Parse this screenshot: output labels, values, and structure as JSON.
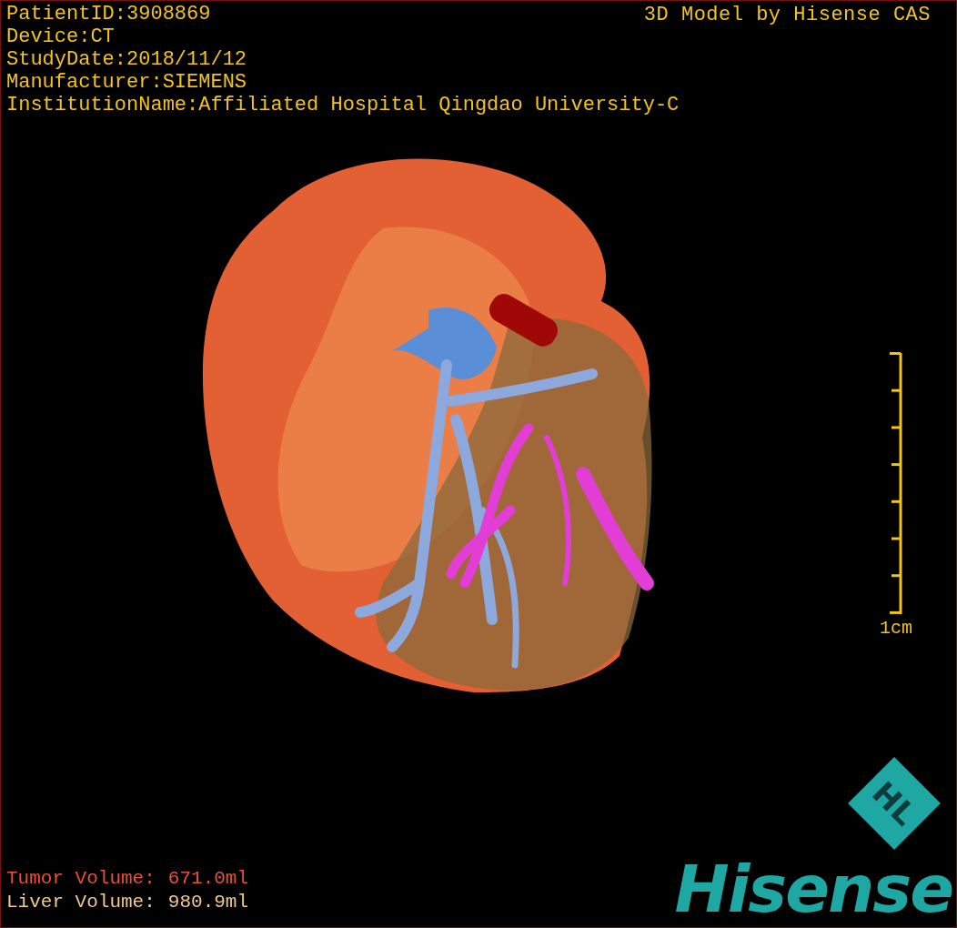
{
  "study_info": [
    "PatientID:3908869",
    "Device:CT",
    "StudyDate:2018/11/12",
    "Manufacturer:SIEMENS",
    "InstitutionName:Affiliated Hospital Qingdao University-C"
  ],
  "caption": "3D Model by Hisense CAS",
  "scale_bar": {
    "label": "1cm"
  },
  "volumes": [
    {
      "label": "Tumor Volume:",
      "value": "671.0ml",
      "color": "#e8503a"
    },
    {
      "label": "Liver Volume:",
      "value": "980.9ml",
      "color": "#f0c890"
    }
  ],
  "logo": {
    "mark": "HL",
    "wordmark": "Hisense"
  }
}
